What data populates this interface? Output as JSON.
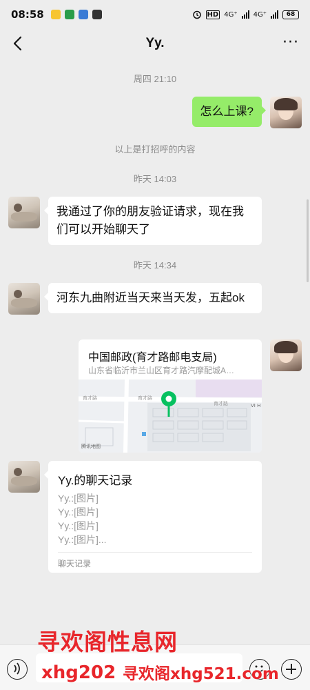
{
  "status_bar": {
    "time": "08:58",
    "network_1": "4G⁺",
    "network_2": "4G⁺",
    "hd_label": "HD",
    "battery": "68"
  },
  "header": {
    "title": "Yy.",
    "back_icon": "chevron-left-icon",
    "more_icon": "more-dots-icon",
    "more_text": "···"
  },
  "chat": {
    "ts1": "周四 21:10",
    "msg1": "怎么上课?",
    "greet_notice": "以上是打招呼的内容",
    "ts2": "昨天 14:03",
    "msg2": "我通过了你的朋友验证请求，现在我们可以开始聊天了",
    "ts3": "昨天 14:34",
    "msg3": "河东九曲附近当天来当天发，五起ok",
    "location": {
      "name": "中国邮政(育才路邮电支局)",
      "address": "山东省临沂市兰山区育才路汽摩配城A…",
      "map_label_1": "育才路",
      "map_label_2": "育才路",
      "map_label_3": "育才路",
      "map_label_4": "VI H",
      "map_credit": "腾讯地图"
    },
    "record": {
      "title": "Yy.的聊天记录",
      "lines": [
        "Yy.:[图片]",
        "Yy.:[图片]",
        "Yy.:[图片]",
        "Yy.:[图片]..."
      ],
      "footer": "聊天记录"
    }
  },
  "watermark": {
    "cn_title": "寻欢阁性息网",
    "url_left": "xhg202",
    "url_right": "寻欢阁xhg521.com"
  },
  "colors": {
    "bg": "#ededed",
    "green_bubble": "#95ec69",
    "pin": "#07c160",
    "watermark": "#e8262b"
  }
}
